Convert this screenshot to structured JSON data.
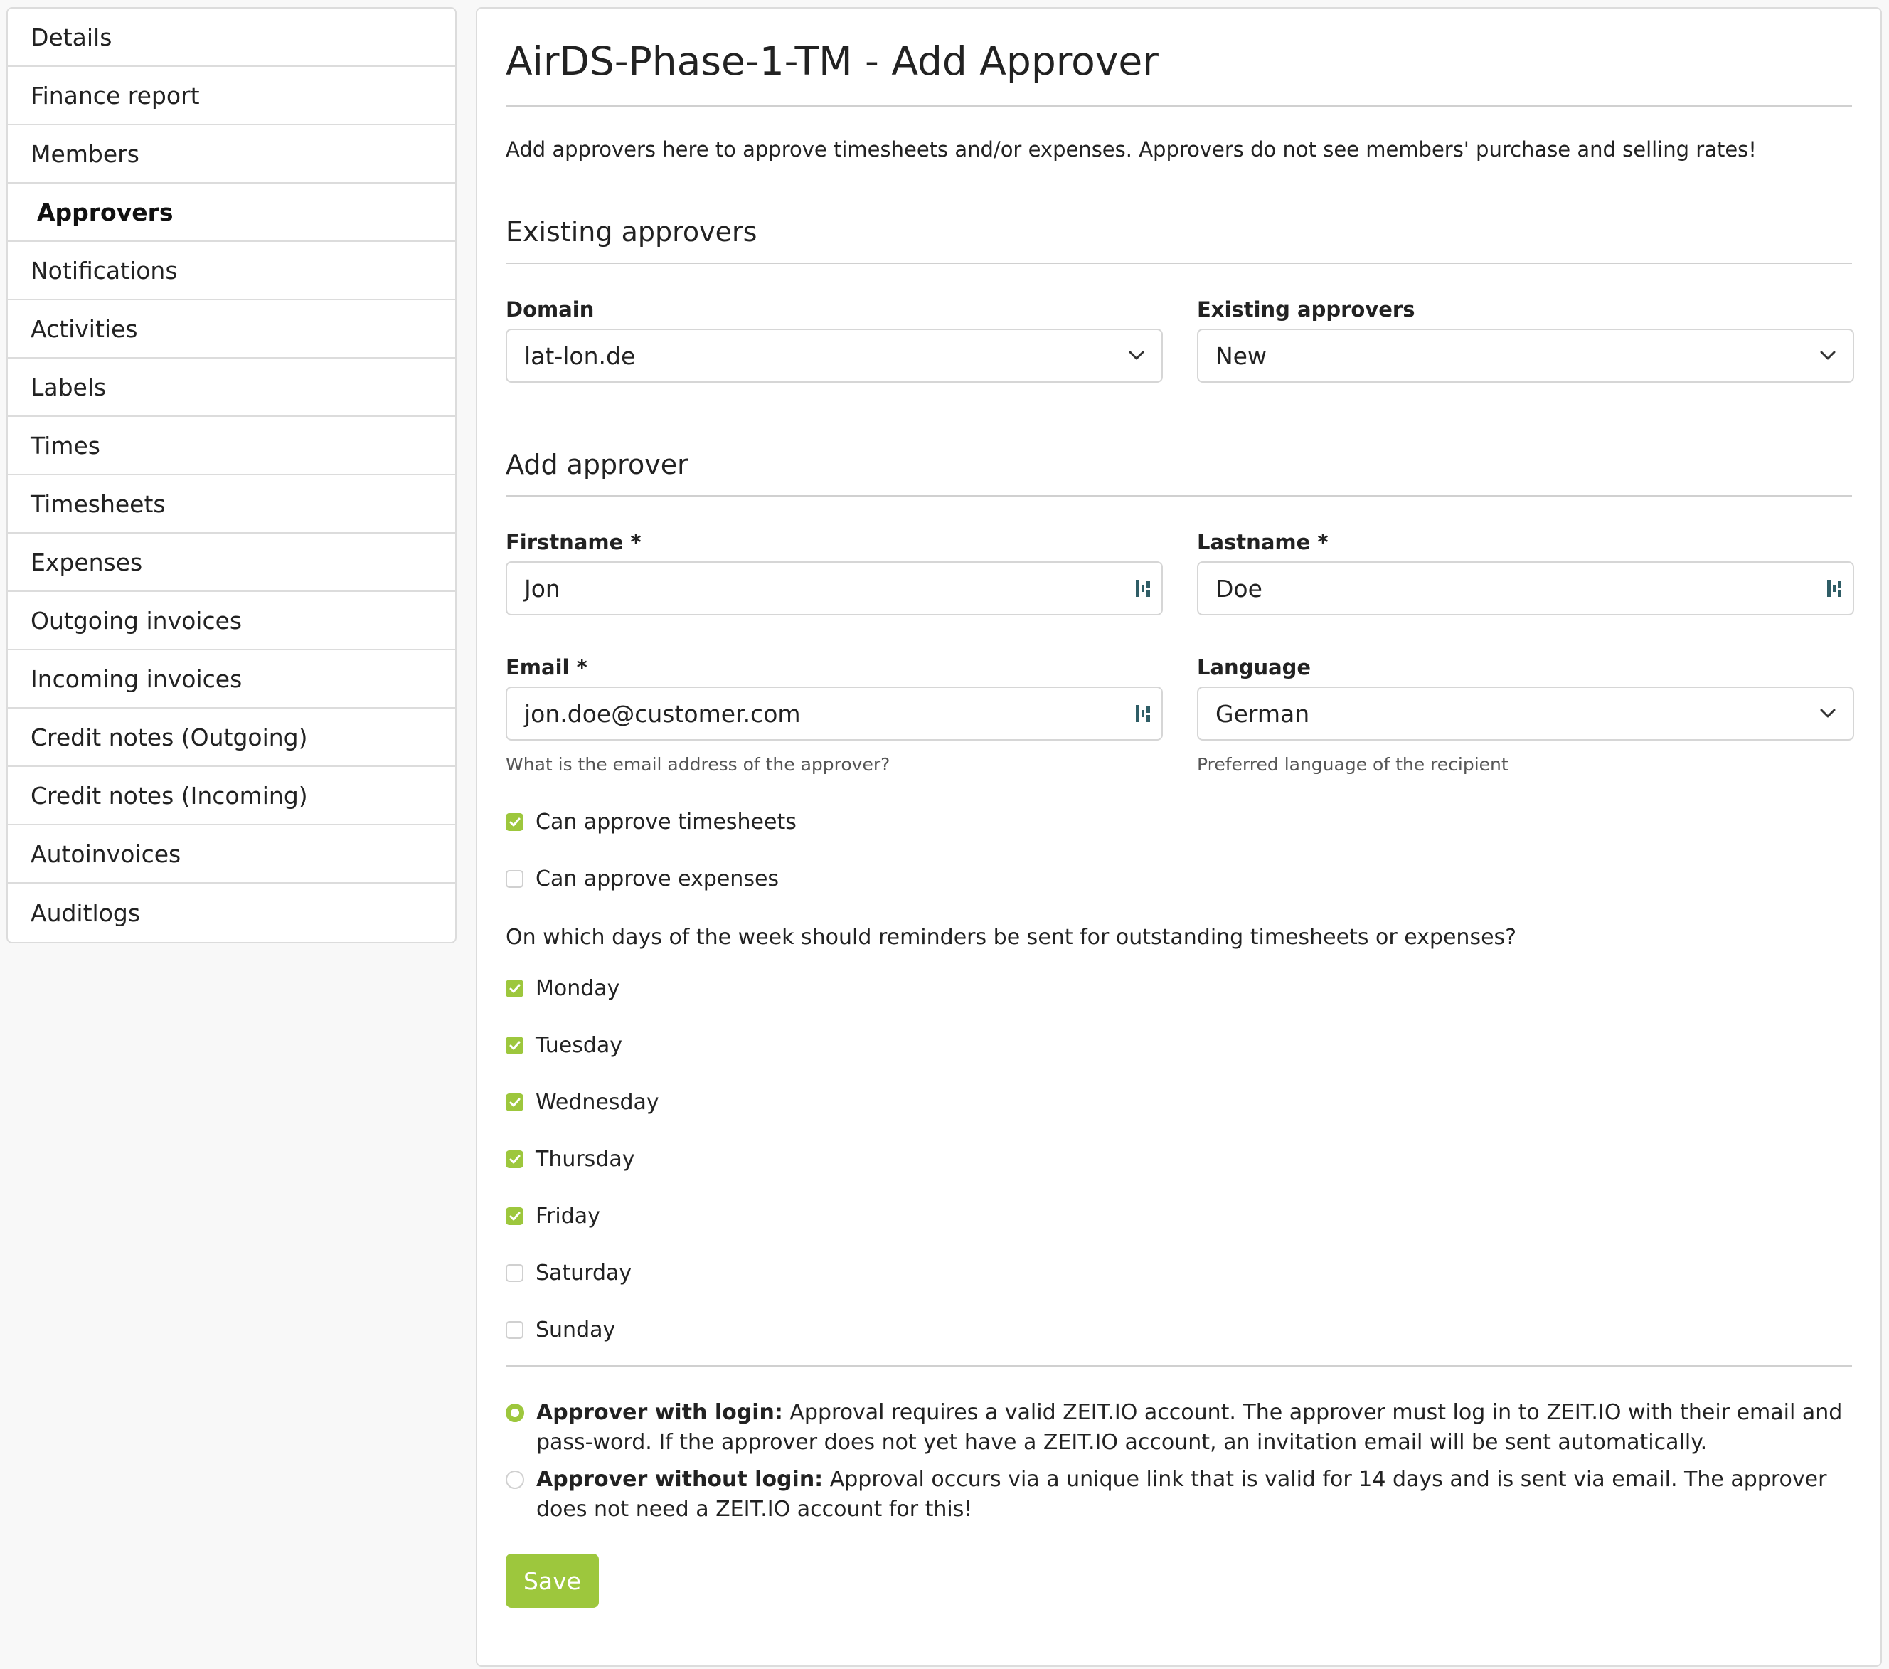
{
  "sidebar": {
    "items": [
      {
        "label": "Details"
      },
      {
        "label": "Finance report"
      },
      {
        "label": "Members"
      },
      {
        "label": "Approvers",
        "active": true
      },
      {
        "label": "Notifications"
      },
      {
        "label": "Activities"
      },
      {
        "label": "Labels"
      },
      {
        "label": "Times"
      },
      {
        "label": "Timesheets"
      },
      {
        "label": "Expenses"
      },
      {
        "label": "Outgoing invoices"
      },
      {
        "label": "Incoming invoices"
      },
      {
        "label": "Credit notes (Outgoing)"
      },
      {
        "label": "Credit notes (Incoming)"
      },
      {
        "label": "Autoinvoices"
      },
      {
        "label": "Auditlogs"
      }
    ]
  },
  "page": {
    "title": "AirDS-Phase-1-TM - Add Approver",
    "intro": "Add approvers here to approve timesheets and/or expenses. Approvers do not see members' purchase and selling rates!"
  },
  "existing": {
    "heading": "Existing approvers",
    "domain_label": "Domain",
    "domain_value": "lat-lon.de",
    "approvers_label": "Existing approvers",
    "approvers_value": "New"
  },
  "add": {
    "heading": "Add approver",
    "firstname_label": "Firstname *",
    "firstname_value": "Jon",
    "lastname_label": "Lastname *",
    "lastname_value": "Doe",
    "email_label": "Email *",
    "email_value": "jon.doe@customer.com",
    "email_help": "What is the email address of the approver?",
    "language_label": "Language",
    "language_value": "German",
    "language_help": "Preferred language of the recipient"
  },
  "permissions": [
    {
      "label": "Can approve timesheets",
      "checked": true
    },
    {
      "label": "Can approve expenses",
      "checked": false
    }
  ],
  "reminders": {
    "question": "On which days of the week should reminders be sent for outstanding timesheets or expenses?",
    "days": [
      {
        "label": "Monday",
        "checked": true
      },
      {
        "label": "Tuesday",
        "checked": true
      },
      {
        "label": "Wednesday",
        "checked": true
      },
      {
        "label": "Thursday",
        "checked": true
      },
      {
        "label": "Friday",
        "checked": true
      },
      {
        "label": "Saturday",
        "checked": false
      },
      {
        "label": "Sunday",
        "checked": false
      }
    ]
  },
  "approver_type": {
    "with_login_title": "Approver with login:",
    "with_login_text": " Approval requires a valid ZEIT.IO account. The approver must log in to ZEIT.IO with their email and pass-word. If the approver does not yet have a ZEIT.IO account, an invitation email will be sent automatically.",
    "with_login_selected": true,
    "without_login_title": "Approver without login:",
    "without_login_text": " Approval occurs via a unique link that is valid for 14 days and is sent via email. The approver does not need a ZEIT.IO account for this!",
    "without_login_selected": false
  },
  "actions": {
    "save_label": "Save"
  },
  "colors": {
    "accent": "#9dc73d",
    "keypass_icon": "#2f5d66"
  }
}
